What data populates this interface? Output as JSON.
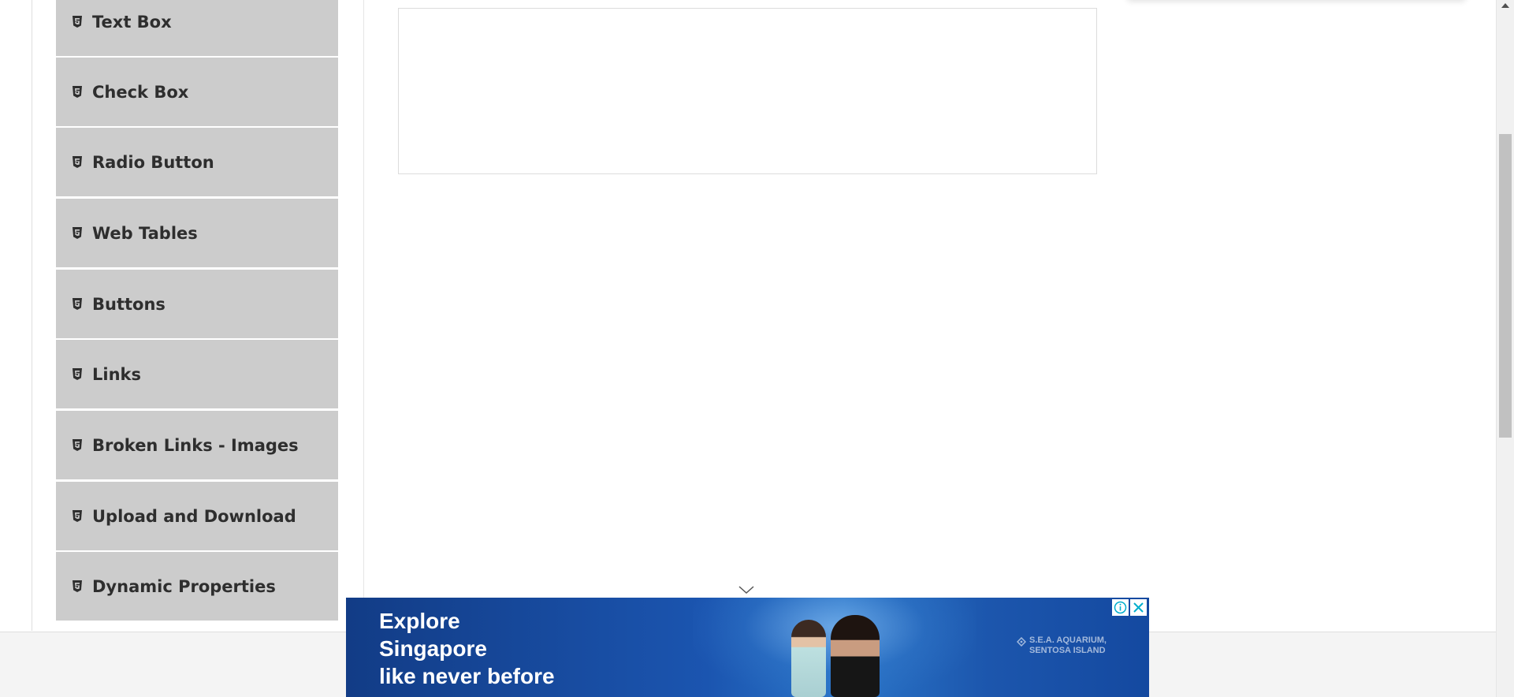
{
  "sidebar": {
    "items": [
      {
        "label": "Text Box",
        "icon": "html5-icon"
      },
      {
        "label": "Check Box",
        "icon": "html5-icon"
      },
      {
        "label": "Radio Button",
        "icon": "html5-icon"
      },
      {
        "label": "Web Tables",
        "icon": "html5-icon"
      },
      {
        "label": "Buttons",
        "icon": "html5-icon"
      },
      {
        "label": "Links",
        "icon": "html5-icon"
      },
      {
        "label": "Broken Links - Images",
        "icon": "html5-icon"
      },
      {
        "label": "Upload and Download",
        "icon": "html5-icon"
      },
      {
        "label": "Dynamic Properties",
        "icon": "html5-icon"
      }
    ]
  },
  "ad": {
    "headline_lines": [
      "Explore",
      "Singapore",
      "like never before"
    ],
    "location_lines": [
      "S.E.A. AQUARIUM,",
      "SENTOSA ISLAND"
    ],
    "info_icon": "info-icon",
    "close_icon": "close-icon"
  },
  "colors": {
    "sidebar_item_bg": "#cccccc",
    "sidebar_text": "#2e2e2e",
    "ad_blue": "#1b55b0",
    "ad_control_accent": "#00aecd"
  }
}
